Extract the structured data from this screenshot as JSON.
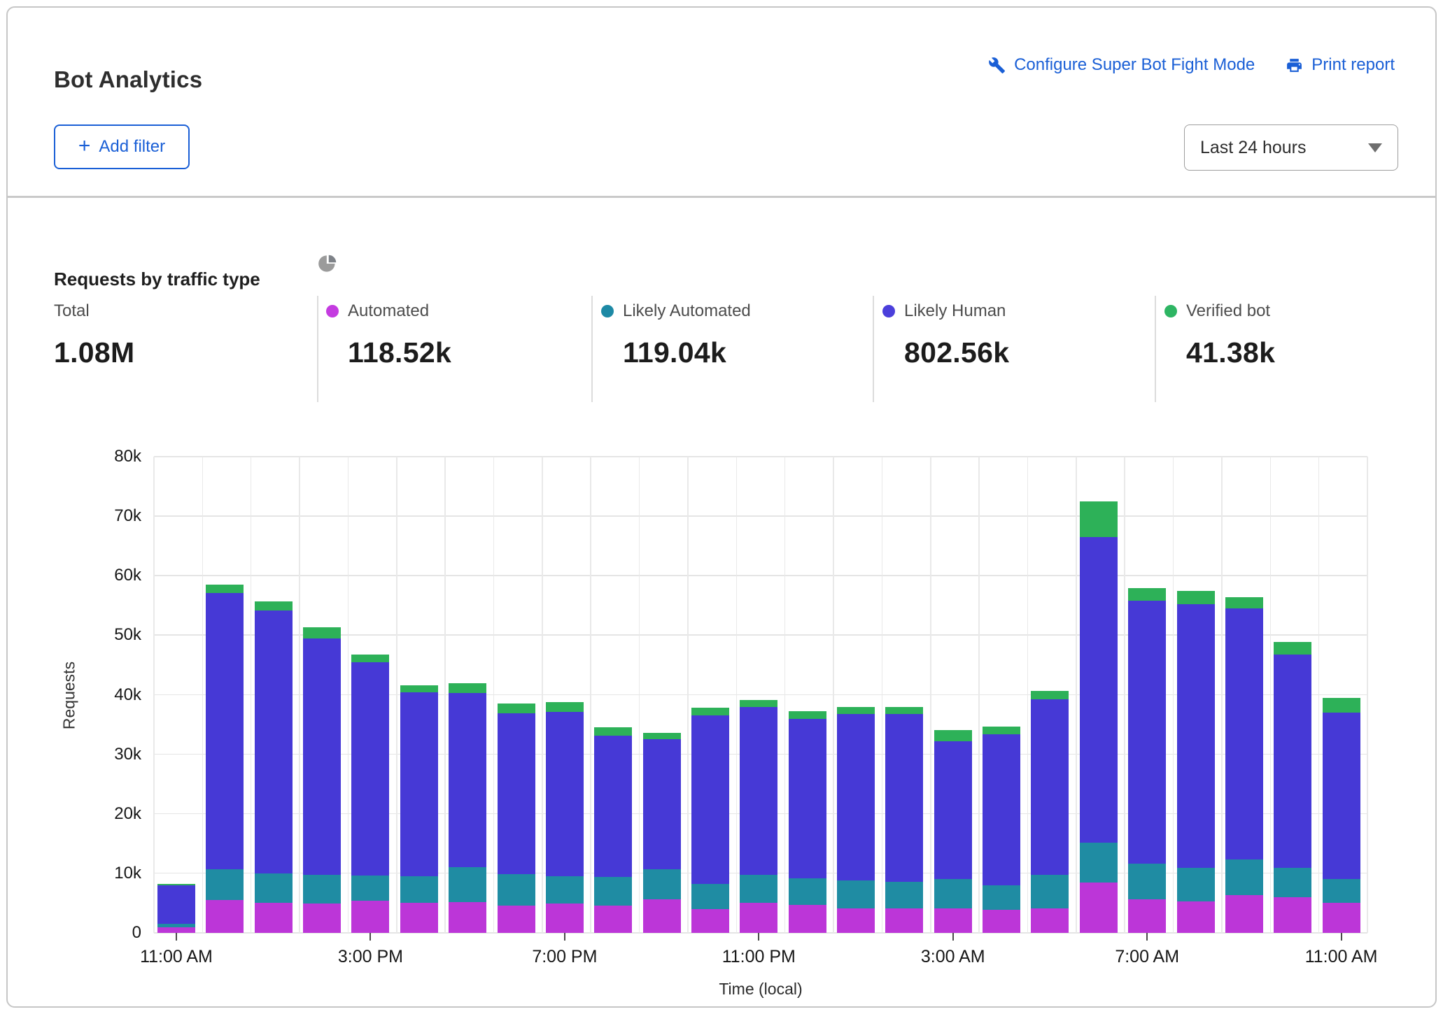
{
  "header": {
    "title": "Bot Analytics",
    "configure_link": "Configure Super Bot Fight Mode",
    "print_link": "Print report"
  },
  "filters": {
    "add_filter_label": "Add filter",
    "time_range_value": "Last 24 hours"
  },
  "section": {
    "title": "Requests by traffic type"
  },
  "stats": {
    "items": [
      {
        "label": "Total",
        "value": "1.08M"
      },
      {
        "label": "Automated",
        "value": "118.52k",
        "dot": "#c43be0"
      },
      {
        "label": "Likely Automated",
        "value": "119.04k",
        "dot": "#1d89a5"
      },
      {
        "label": "Likely Human",
        "value": "802.56k",
        "dot": "#4b3fdb"
      },
      {
        "label": "Verified bot",
        "value": "41.38k",
        "dot": "#2eb563"
      }
    ]
  },
  "colors": {
    "link_blue": "#1a5fd6",
    "card_border": "#c6c6c6",
    "grid": "#e5e5e5",
    "automated": "#bc36d8",
    "likely_automated": "#1f8ca3",
    "likely_human": "#4639d6",
    "verified_bot": "#2db158"
  },
  "chart_data": {
    "type": "bar",
    "stacked": true,
    "title": "Requests by traffic type",
    "xlabel": "Time (local)",
    "ylabel": "Requests",
    "ylim": [
      0,
      80000
    ],
    "ytick_step": 10000,
    "label_every": 4,
    "grid": true,
    "legend_position": "top-stats-row",
    "categories": [
      "11:00 AM",
      "12:00 PM",
      "1:00 PM",
      "2:00 PM",
      "3:00 PM",
      "4:00 PM",
      "5:00 PM",
      "6:00 PM",
      "7:00 PM",
      "8:00 PM",
      "9:00 PM",
      "10:00 PM",
      "11:00 PM",
      "12:00 AM",
      "1:00 AM",
      "2:00 AM",
      "3:00 AM",
      "4:00 AM",
      "5:00 AM",
      "6:00 AM",
      "7:00 AM",
      "8:00 AM",
      "9:00 AM",
      "10:00 AM",
      "11:00 AM"
    ],
    "series": [
      {
        "name": "Automated",
        "color": "#bc36d8",
        "values": [
          1000,
          5500,
          5000,
          4900,
          5400,
          5100,
          5200,
          4600,
          4900,
          4600,
          5600,
          4000,
          5000,
          4700,
          4100,
          4100,
          4100,
          3900,
          4100,
          8500,
          5600,
          5300,
          6400,
          6000,
          5000
        ]
      },
      {
        "name": "Likely Automated",
        "color": "#1f8ca3",
        "values": [
          500,
          5200,
          5000,
          4900,
          4200,
          4400,
          5900,
          5300,
          4600,
          4800,
          5100,
          4200,
          4700,
          4500,
          4700,
          4500,
          5000,
          4100,
          5600,
          6700,
          6000,
          5600,
          5900,
          4900,
          4100
        ]
      },
      {
        "name": "Likely Human",
        "color": "#4639d6",
        "values": [
          6500,
          46400,
          44200,
          39700,
          35900,
          30900,
          29200,
          27000,
          27600,
          23700,
          21800,
          28300,
          28300,
          26700,
          28000,
          28200,
          23100,
          25400,
          29500,
          51300,
          44200,
          44300,
          42200,
          35900,
          27900
        ]
      },
      {
        "name": "Verified bot",
        "color": "#2db158",
        "values": [
          200,
          1400,
          1500,
          1800,
          1300,
          1200,
          1700,
          1600,
          1700,
          1400,
          1100,
          1300,
          1100,
          1300,
          1100,
          1200,
          1900,
          1300,
          1400,
          6000,
          2100,
          2200,
          1900,
          2100,
          2500
        ]
      }
    ]
  }
}
